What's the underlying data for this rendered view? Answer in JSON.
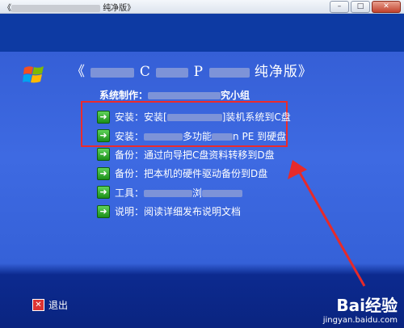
{
  "window": {
    "title_prefix": "《",
    "title_suffix": "纯净版》",
    "buttons": {
      "minimize": "–",
      "maximize": "□",
      "close": "✕"
    }
  },
  "app": {
    "heading_open": "《",
    "heading_mid": "C",
    "heading_mid2": "P",
    "heading_close": "纯净版》",
    "producer_label": "系统制作：",
    "producer_suffix": "究小组"
  },
  "menu": {
    "items": [
      {
        "label_start": "安装：安装[",
        "label_end": "]装机系统到C盘"
      },
      {
        "label_start": "安装：",
        "label_mid": "多功能",
        "label_end": "n PE 到硬盘"
      },
      {
        "label": "备份：通过向导把C盘资料转移到D盘"
      },
      {
        "label": "备份：把本机的硬件驱动备份到D盘"
      },
      {
        "label_start": "工具：",
        "label_end": "浏"
      },
      {
        "label": "说明：阅读详细发布说明文档"
      }
    ]
  },
  "footer": {
    "exit_label": "退出"
  },
  "watermark": {
    "main": "Bai经验",
    "sub": "jingyan.baidu.com"
  },
  "colors": {
    "highlight": "#ec2b2b",
    "background": "#3e6ae2"
  }
}
